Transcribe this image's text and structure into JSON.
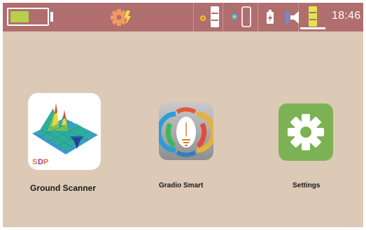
{
  "status_bar": {
    "time": "18:46",
    "icons": [
      "battery-icon",
      "settings-alert-icon",
      "sensor-indicator-icon",
      "gauge-level-icon",
      "gps-indicator-icon",
      "phone-icon",
      "power-icon",
      "bluetooth-icon",
      "volume-icon",
      "volume-level-icon"
    ],
    "colors": {
      "background": "#b06e6e",
      "battery_fill": "#b7cf4a",
      "gear": "#f19a63"
    }
  },
  "apps": [
    {
      "label": "Ground Scanner",
      "icon": "ground-scanner-3d-map-icon"
    },
    {
      "label": "Gradio Smart",
      "icon": "gradio-smart-icon"
    },
    {
      "label": "Settings",
      "icon": "settings-gear-icon"
    }
  ],
  "brand": {
    "logo_text": "SDP"
  },
  "colors": {
    "screen_background": "#dcc9b6",
    "settings_icon": "#7cb253"
  }
}
